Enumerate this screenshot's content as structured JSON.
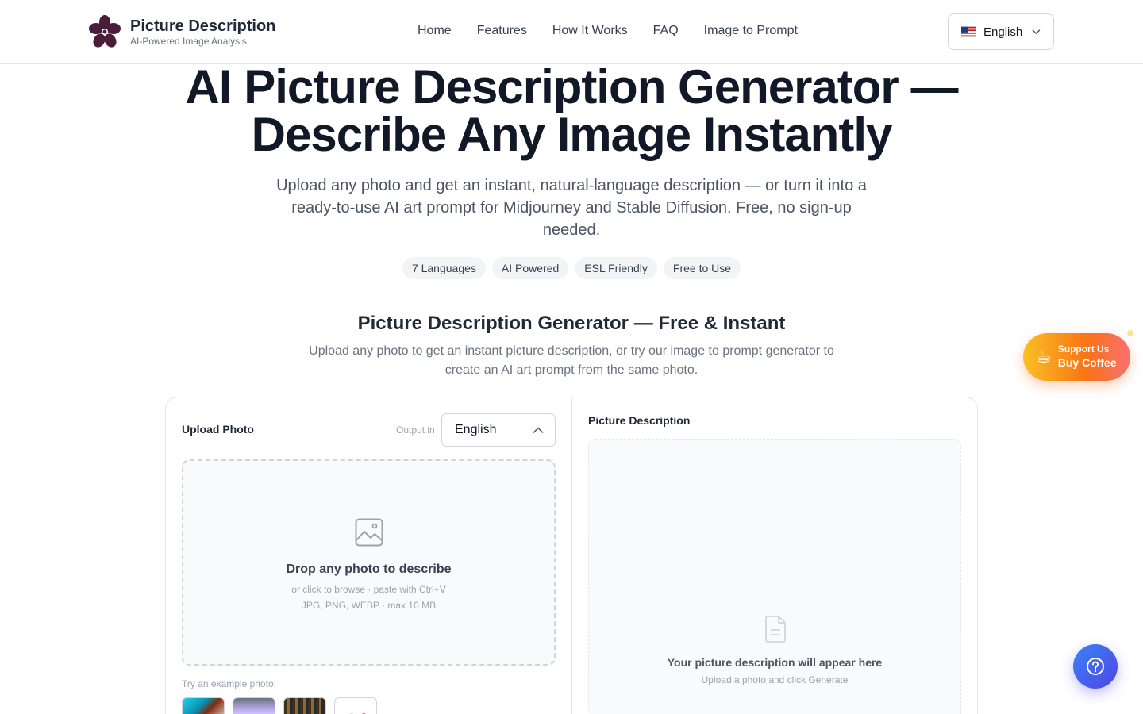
{
  "header": {
    "brand_title": "Picture Description",
    "brand_subtitle": "AI-Powered Image Analysis",
    "nav": [
      "Home",
      "Features",
      "How It Works",
      "FAQ",
      "Image to Prompt"
    ],
    "language": "English",
    "language_flag_icon": "us-flag-icon"
  },
  "hero": {
    "title_line1": "AI Picture Description Generator —",
    "title_line2": "Describe Any Image Instantly",
    "subtitle": "Upload any photo and get an instant, natural-language description — or turn it into a ready-to-use AI art prompt for Midjourney and Stable Diffusion. Free, no sign-up needed.",
    "tags": [
      "7 Languages",
      "AI Powered",
      "ESL Friendly",
      "Free to Use"
    ]
  },
  "section": {
    "title": "Picture Description Generator — Free & Instant",
    "subtitle": "Upload any photo to get an instant picture description, or try our image to prompt generator to create an AI art prompt from the same photo."
  },
  "tool": {
    "upload_label": "Upload Photo",
    "output_in_label": "Output in",
    "output_language": "English",
    "dropzone_title": "Drop any photo to describe",
    "dropzone_hint": "or click to browse · paste with Ctrl+V",
    "dropzone_formats": "JPG, PNG, WEBP · max 10 MB",
    "examples_label": "Try an example photo:",
    "description_label": "Picture Description",
    "description_placeholder_title": "Your picture description will appear here",
    "description_placeholder_sub": "Upload a photo and click Generate"
  },
  "floating": {
    "coffee_small": "Support Us",
    "coffee_big": "Buy Coffee",
    "coffee_emoji": "☕"
  },
  "colors": {
    "brand_logo": "#4a1d3a",
    "help_button": "#4f46e5",
    "coffee_gradient": "#f97316"
  }
}
